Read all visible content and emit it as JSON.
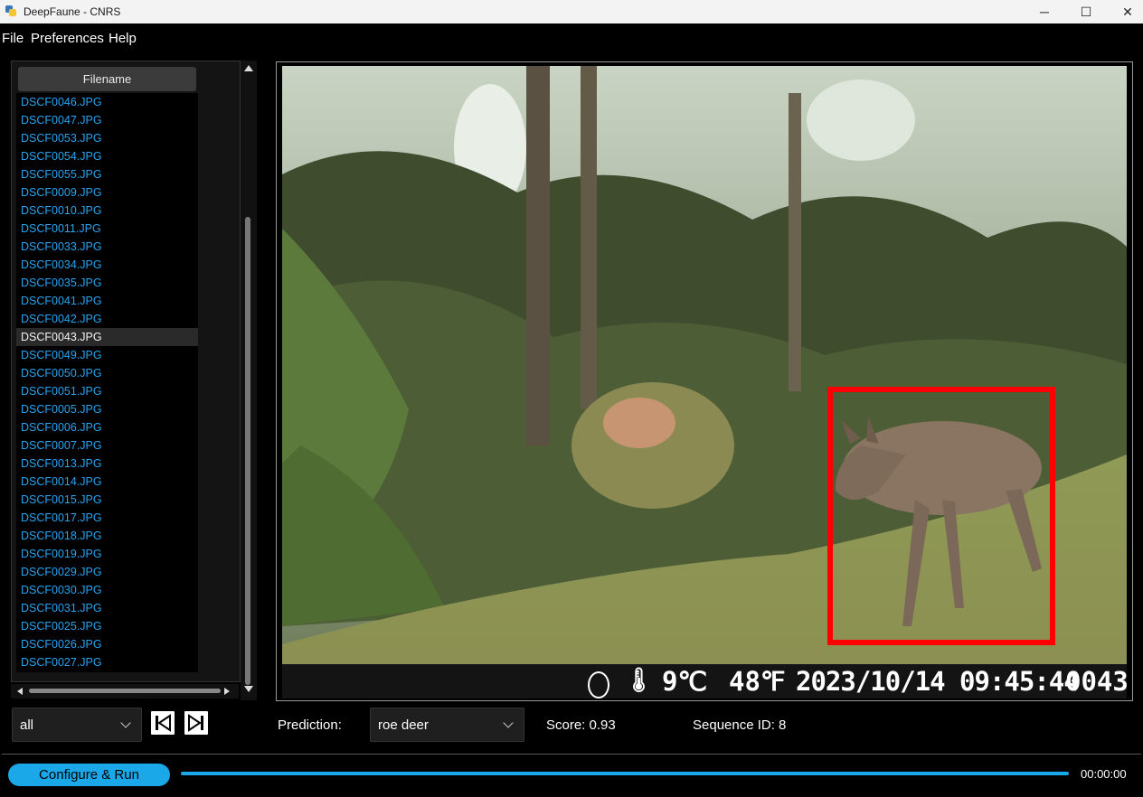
{
  "window": {
    "title": "DeepFaune - CNRS",
    "minimize_glyph": "─",
    "maximize_glyph": "☐",
    "close_glyph": "✕"
  },
  "menu": {
    "file": "File",
    "preferences": "Preferences",
    "help": "Help"
  },
  "file_panel": {
    "header": "Filename",
    "files": [
      "DSCF0046.JPG",
      "DSCF0047.JPG",
      "DSCF0053.JPG",
      "DSCF0054.JPG",
      "DSCF0055.JPG",
      "DSCF0009.JPG",
      "DSCF0010.JPG",
      "DSCF0011.JPG",
      "DSCF0033.JPG",
      "DSCF0034.JPG",
      "DSCF0035.JPG",
      "DSCF0041.JPG",
      "DSCF0042.JPG",
      "DSCF0043.JPG",
      "DSCF0049.JPG",
      "DSCF0050.JPG",
      "DSCF0051.JPG",
      "DSCF0005.JPG",
      "DSCF0006.JPG",
      "DSCF0007.JPG",
      "DSCF0013.JPG",
      "DSCF0014.JPG",
      "DSCF0015.JPG",
      "DSCF0017.JPG",
      "DSCF0018.JPG",
      "DSCF0019.JPG",
      "DSCF0029.JPG",
      "DSCF0030.JPG",
      "DSCF0031.JPG",
      "DSCF0025.JPG",
      "DSCF0026.JPG",
      "DSCF0027.JPG"
    ],
    "selected": "DSCF0043.JPG"
  },
  "stamp": {
    "thermometer": "🌡",
    "temp_c": "9℃",
    "temp_f": "48℉",
    "datetime": "2023/10/14 09:45:44",
    "frame": "0043"
  },
  "controls": {
    "filter_value": "all",
    "prediction_label": "Prediction:",
    "prediction_value": "roe deer",
    "score": "Score: 0.93",
    "sequence": "Sequence ID: 8"
  },
  "run": {
    "button_label": "Configure & Run",
    "elapsed": "00:00:00"
  },
  "colors": {
    "accent": "#1aa8e8",
    "file_link": "#27a3ef",
    "bbox": "#ff0000"
  }
}
